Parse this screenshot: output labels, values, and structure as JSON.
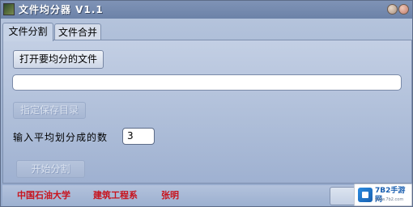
{
  "window": {
    "title": "文件均分器 V1.1"
  },
  "tabs": [
    {
      "label": "文件分割",
      "active": true
    },
    {
      "label": "文件合并",
      "active": false
    }
  ],
  "split_panel": {
    "open_button_label": "打开要均分的文件",
    "file_path_value": "",
    "save_dir_button_label": "指定保存目录",
    "parts_label": "输入平均划分成的数",
    "parts_value": "3",
    "start_button_label": "开始分割"
  },
  "status": {
    "school": "中国石油大学",
    "department": "建筑工程系",
    "author": "张明"
  },
  "watermark": {
    "brand": "7B2手游网",
    "sub": "www.7b2.com"
  },
  "colors": {
    "credit_text": "#c8141e",
    "window_bg": "#a4b6d3",
    "titlebar": "#6c82a8"
  },
  "icons": {
    "app": "app-icon",
    "minimize": "minimize-icon",
    "close": "close-icon"
  }
}
